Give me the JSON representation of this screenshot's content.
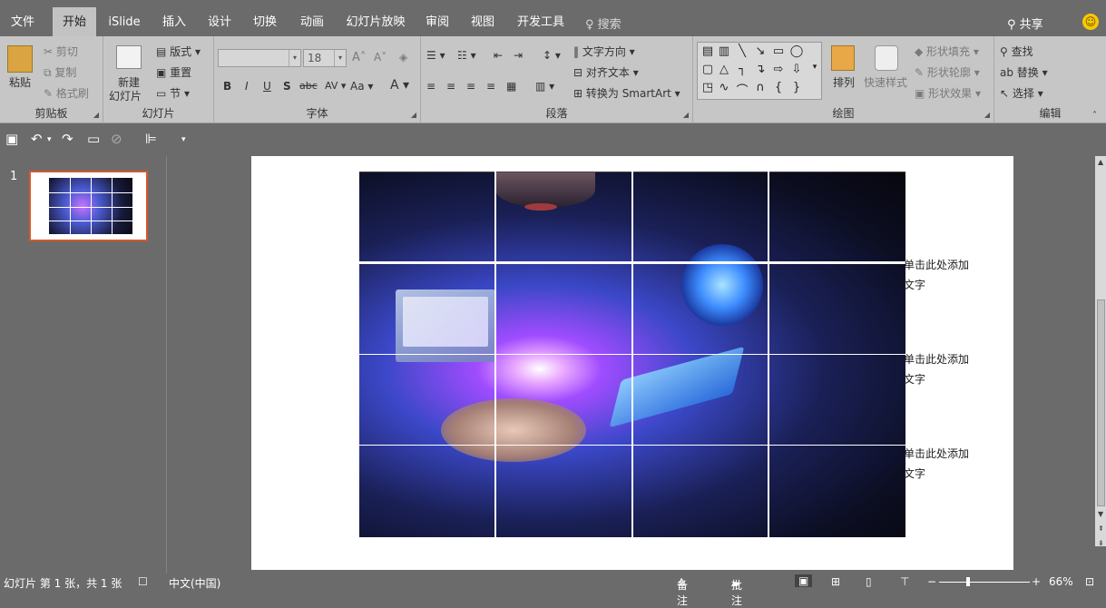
{
  "tabs": [
    "文件",
    "开始",
    "iSlide",
    "插入",
    "设计",
    "切换",
    "动画",
    "幻灯片放映",
    "审阅",
    "视图",
    "开发工具"
  ],
  "search_label": "搜索",
  "share_label": "共享",
  "ribbon": {
    "clipboard": {
      "paste": "粘贴",
      "cut": "剪切",
      "copy": "复制",
      "format_painter": "格式刷",
      "group": "剪贴板"
    },
    "slides": {
      "new_slide_line1": "新建",
      "new_slide_line2": "幻灯片",
      "layout": "版式",
      "reset": "重置",
      "section": "节",
      "group": "幻灯片"
    },
    "font": {
      "size": "18",
      "bold": "B",
      "italic": "I",
      "underline": "U",
      "shadow": "S",
      "strike": "abc",
      "spacing": "AV",
      "case": "Aa",
      "color": "A",
      "group": "字体"
    },
    "paragraph": {
      "text_direction": "文字方向",
      "align_text": "对齐文本",
      "convert_smartart": "转换为 SmartArt",
      "group": "段落"
    },
    "drawing": {
      "arrange": "排列",
      "quick_styles": "快速样式",
      "shape_fill": "形状填充",
      "shape_outline": "形状轮廓",
      "shape_effects": "形状效果",
      "group": "绘图"
    },
    "editing": {
      "find": "查找",
      "replace": "替换",
      "select": "选择",
      "group": "编辑"
    }
  },
  "slide_number": "1",
  "placeholders": [
    {
      "line1": "单击此处添加",
      "line2": "文字"
    },
    {
      "line1": "单击此处添加",
      "line2": "文字"
    },
    {
      "line1": "单击此处添加",
      "line2": "文字"
    }
  ],
  "status": {
    "slide_info": "幻灯片 第 1 张，共 1 张",
    "language": "中文(中国)",
    "notes": "备注",
    "comments": "批注",
    "zoom": "66%"
  }
}
